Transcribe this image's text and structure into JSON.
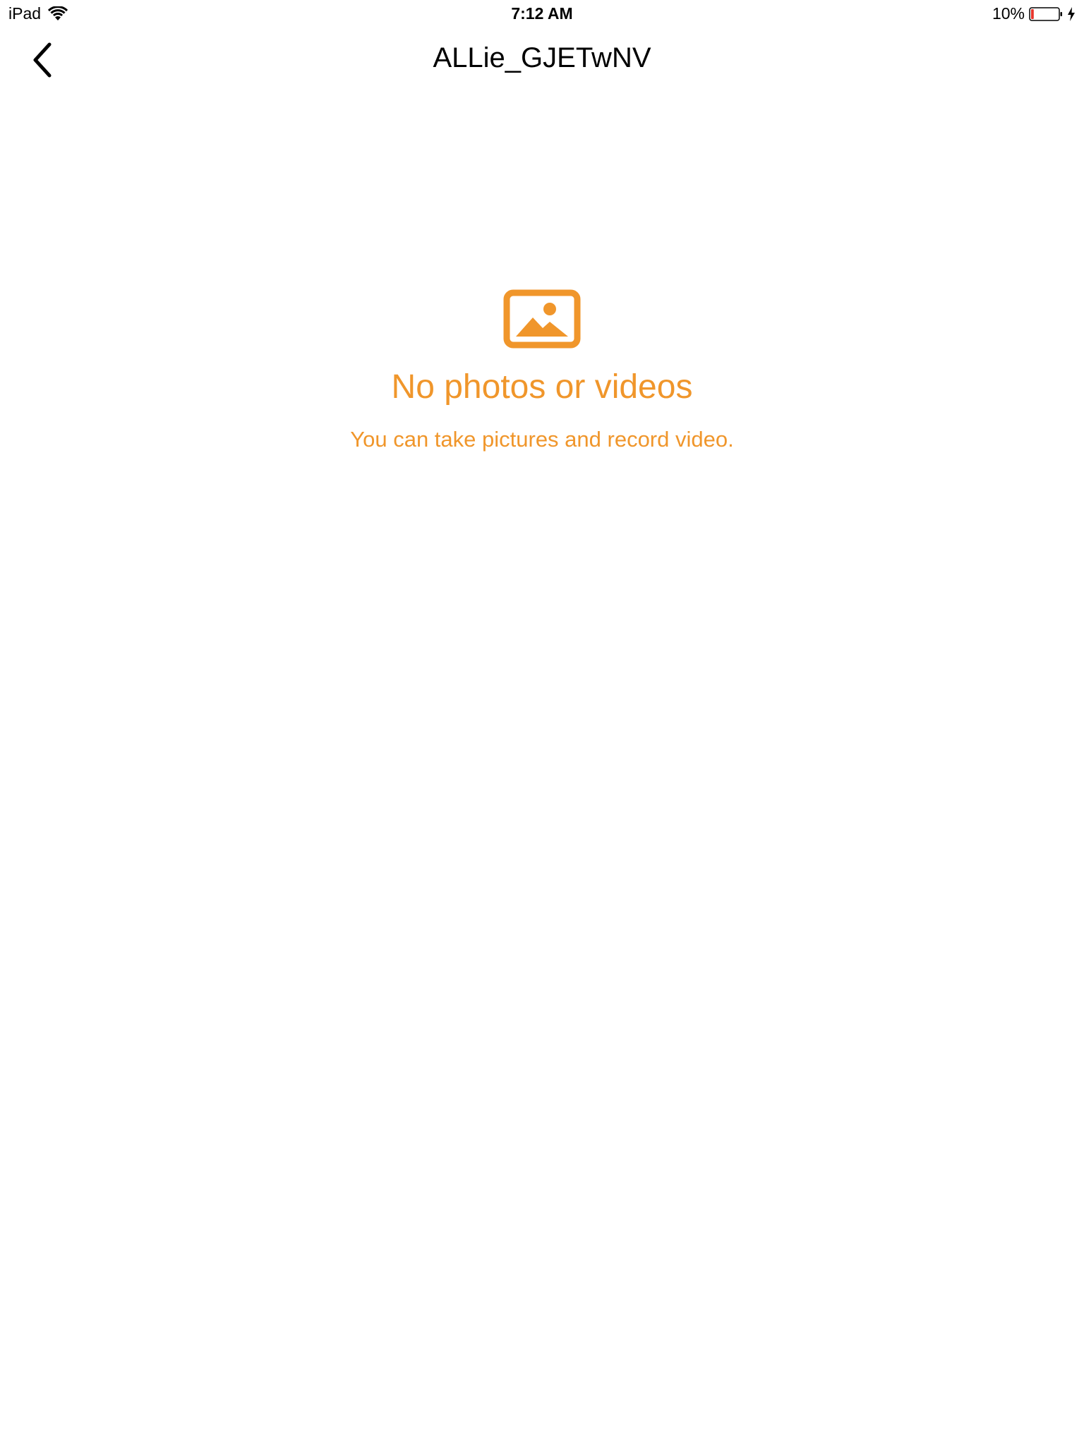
{
  "status_bar": {
    "device": "iPad",
    "time": "7:12 AM",
    "battery_percent": "10%",
    "battery_level": 0.1,
    "icons": [
      "wifi-icon",
      "battery-icon",
      "charging-icon"
    ]
  },
  "nav": {
    "title": "ALLie_GJETwNV",
    "back_icon": "chevron-left-icon"
  },
  "empty_state": {
    "icon": "photo-icon",
    "title": "No photos or videos",
    "subtitle": "You can take pictures and record video."
  },
  "colors": {
    "accent": "#f0962b",
    "battery_low": "#e8362b",
    "text": "#000000",
    "background": "#ffffff"
  }
}
